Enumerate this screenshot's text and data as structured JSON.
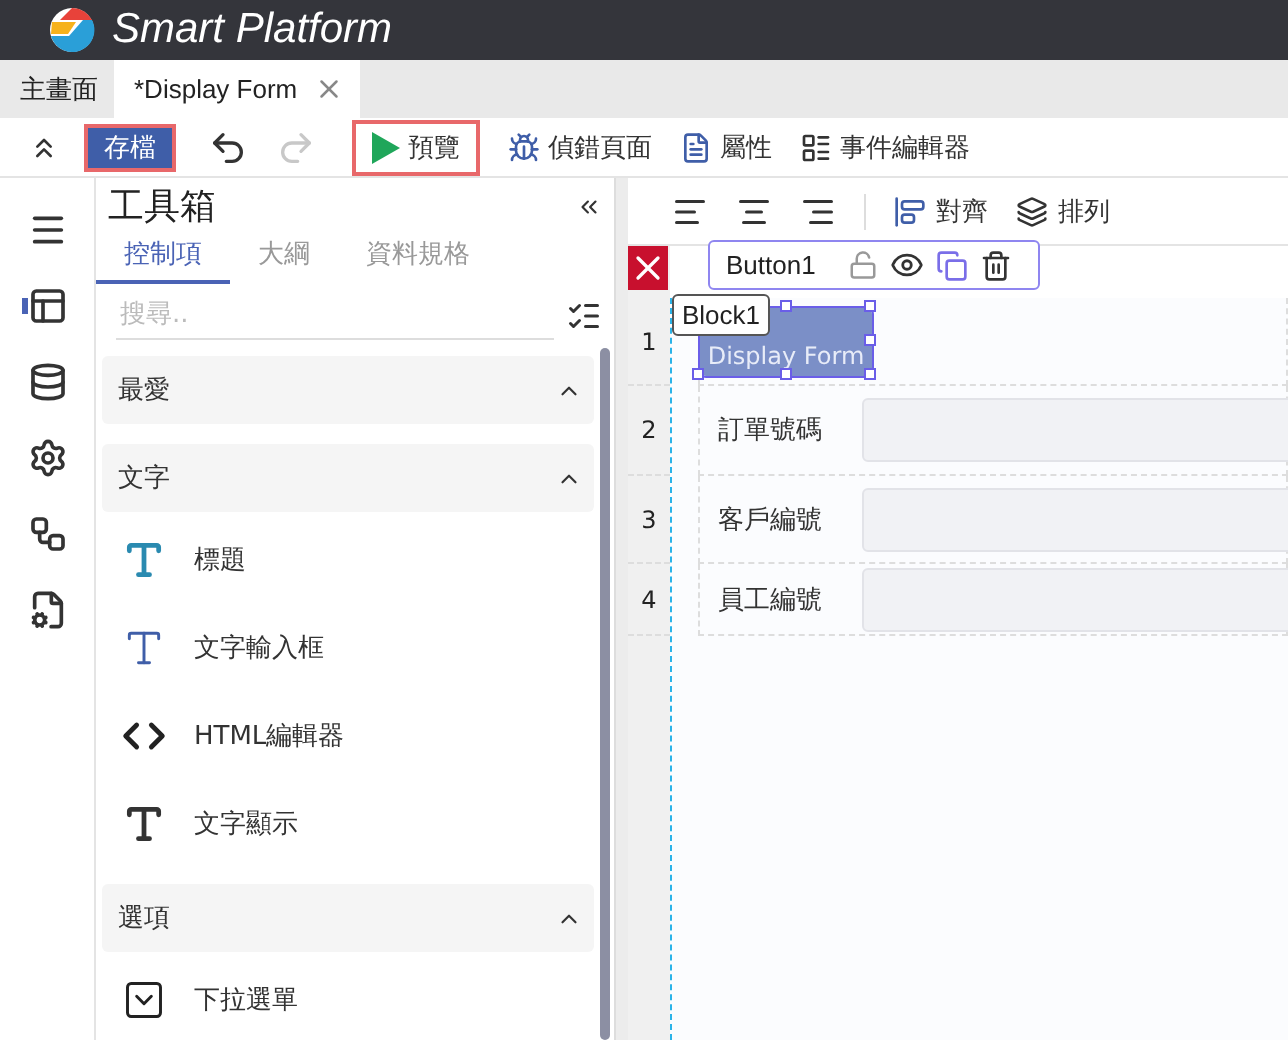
{
  "app": {
    "title": "Smart Platform"
  },
  "tabs": [
    {
      "label": "主畫面",
      "selected": false,
      "closable": false
    },
    {
      "label": "*Display Form",
      "selected": true,
      "closable": true
    }
  ],
  "toolbar": [
    {
      "kind": "collapse"
    },
    {
      "kind": "save",
      "label": "存檔",
      "highlighted": true
    },
    {
      "kind": "undo",
      "disabled": false
    },
    {
      "kind": "redo",
      "disabled": true
    },
    {
      "kind": "preview",
      "label": "預覽",
      "highlighted": true
    },
    {
      "kind": "debug",
      "label": "偵錯頁面",
      "highlighted": false
    },
    {
      "kind": "properties",
      "label": "屬性",
      "highlighted": false
    },
    {
      "kind": "events",
      "label": "事件編輯器",
      "highlighted": false
    }
  ],
  "rail": [
    {
      "kind": "menu",
      "selected": false
    },
    {
      "kind": "layout",
      "selected": true
    },
    {
      "kind": "database",
      "selected": false
    },
    {
      "kind": "sync-settings",
      "selected": false
    },
    {
      "kind": "flow",
      "selected": false
    },
    {
      "kind": "page-settings",
      "selected": false
    }
  ],
  "toolbox": {
    "title": "工具箱",
    "tabs": [
      {
        "label": "控制項",
        "selected": true
      },
      {
        "label": "大綱",
        "selected": false
      },
      {
        "label": "資料規格",
        "selected": false
      }
    ],
    "search": {
      "placeholder": "搜尋.."
    },
    "groups": [
      {
        "title": "最愛",
        "expanded": true
      },
      {
        "title": "文字",
        "expanded": true,
        "items": [
          {
            "kind": "heading",
            "label": "標題"
          },
          {
            "kind": "textbox",
            "label": "文字輸入框"
          },
          {
            "kind": "html",
            "label": "HTML編輯器"
          },
          {
            "kind": "text",
            "label": "文字顯示"
          }
        ]
      },
      {
        "title": "選項",
        "expanded": true,
        "items": [
          {
            "kind": "dropdown",
            "label": "下拉選單"
          }
        ]
      }
    ]
  },
  "canvas": {
    "toolbar": [
      {
        "kind": "align-left"
      },
      {
        "kind": "align-center"
      },
      {
        "kind": "align-right"
      },
      {
        "kind": "align",
        "label": "對齊"
      },
      {
        "kind": "arrange",
        "label": "排列"
      }
    ],
    "selection": {
      "name": "Button1",
      "locked": false
    },
    "block": "Block1",
    "rows": [
      {
        "number": "1",
        "kind": "button",
        "text": "Display Form",
        "selected": true
      },
      {
        "number": "2",
        "kind": "field",
        "label": "訂單號碼"
      },
      {
        "number": "3",
        "kind": "field",
        "label": "客戶編號"
      },
      {
        "number": "4",
        "kind": "field",
        "label": "員工編號"
      }
    ]
  }
}
